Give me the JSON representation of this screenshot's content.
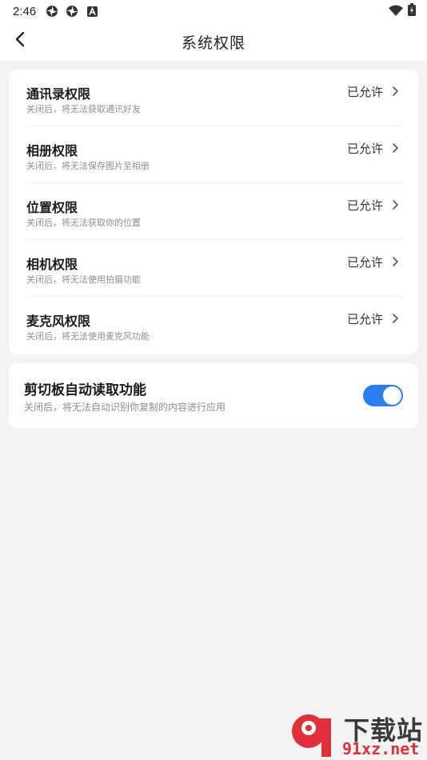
{
  "status_bar": {
    "time": "2:46",
    "icons": [
      "app-badge-icon",
      "app-badge-icon",
      "a-letter-icon",
      "wifi-icon",
      "battery-icon"
    ]
  },
  "header": {
    "title": "系统权限",
    "back_icon": "chevron-left-icon"
  },
  "permissions": [
    {
      "name": "通讯录权限",
      "desc": "关闭后，将无法获取通讯好友",
      "status": "已允许"
    },
    {
      "name": "相册权限",
      "desc": "关闭后，将无法保存图片至相册",
      "status": "已允许"
    },
    {
      "name": "位置权限",
      "desc": "关闭后，将无法获取你的位置",
      "status": "已允许"
    },
    {
      "name": "相机权限",
      "desc": "关闭后，将无法使用拍摄功能",
      "status": "已允许"
    },
    {
      "name": "麦克风权限",
      "desc": "关闭后，将无法使用麦克风功能",
      "status": "已允许"
    }
  ],
  "clipboard": {
    "name": "剪切板自动读取功能",
    "desc": "关闭后，将无法自动识别你复制的内容进行应用",
    "enabled": true
  },
  "watermark": {
    "brand": "下载站",
    "site": "91xz.net"
  },
  "colors": {
    "accent": "#2b7ff0",
    "background": "#f2f3f5",
    "card": "#ffffff",
    "secondary_text": "#8a8d93"
  }
}
